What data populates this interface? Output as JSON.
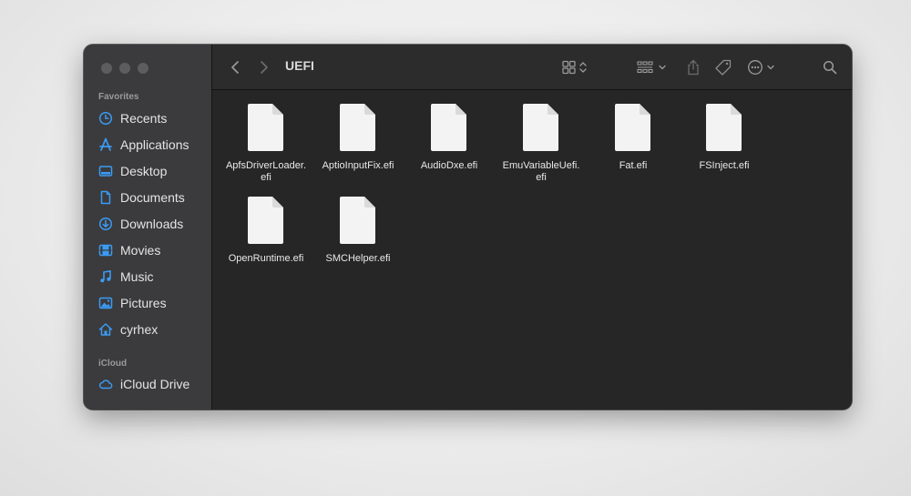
{
  "window": {
    "title": "UEFI"
  },
  "sidebar": {
    "favorites_label": "Favorites",
    "icloud_label": "iCloud",
    "favorites": [
      {
        "label": "Recents",
        "icon": "clock-icon"
      },
      {
        "label": "Applications",
        "icon": "applications-icon"
      },
      {
        "label": "Desktop",
        "icon": "desktop-icon"
      },
      {
        "label": "Documents",
        "icon": "document-icon"
      },
      {
        "label": "Downloads",
        "icon": "download-icon"
      },
      {
        "label": "Movies",
        "icon": "film-icon"
      },
      {
        "label": "Music",
        "icon": "music-note-icon"
      },
      {
        "label": "Pictures",
        "icon": "photo-icon"
      },
      {
        "label": "cyrhex",
        "icon": "home-icon"
      }
    ],
    "icloud": [
      {
        "label": "iCloud Drive",
        "icon": "cloud-icon"
      }
    ]
  },
  "files": [
    {
      "name_line1": "ApfsDriverLoader.",
      "name_line2": "efi"
    },
    {
      "name_line1": "AptioInputFix.efi",
      "name_line2": ""
    },
    {
      "name_line1": "AudioDxe.efi",
      "name_line2": ""
    },
    {
      "name_line1": "EmuVariableUefi.",
      "name_line2": "efi"
    },
    {
      "name_line1": "Fat.efi",
      "name_line2": ""
    },
    {
      "name_line1": "FSInject.efi",
      "name_line2": ""
    },
    {
      "name_line1": "OpenRuntime.efi",
      "name_line2": ""
    },
    {
      "name_line1": "SMCHelper.efi",
      "name_line2": ""
    }
  ],
  "colors": {
    "accent": "#3b9bf5",
    "sidebar_bg": "#3b3b3d",
    "content_bg": "#262626",
    "toolbar_bg": "#2c2c2c"
  }
}
